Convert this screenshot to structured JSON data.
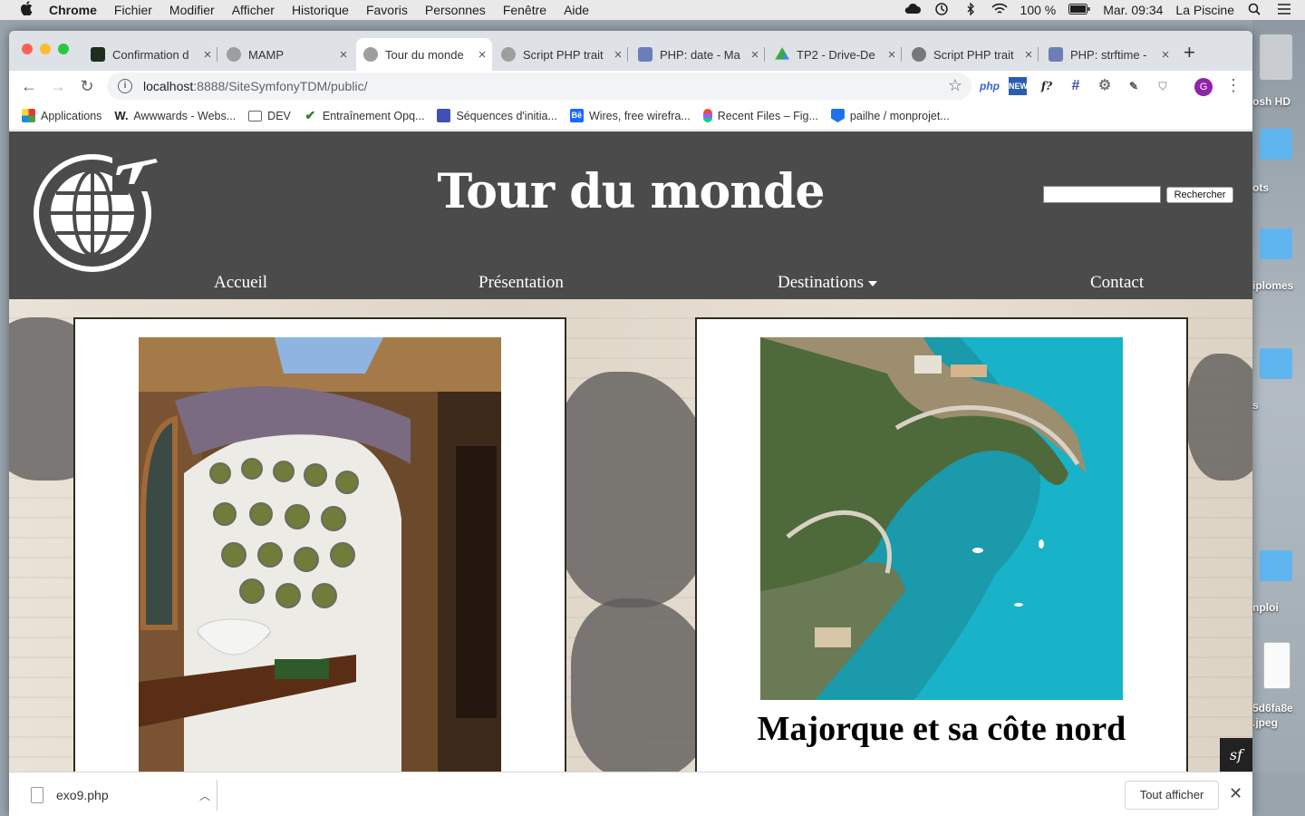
{
  "menubar": {
    "app": "Chrome",
    "items": [
      "Fichier",
      "Modifier",
      "Afficher",
      "Historique",
      "Favoris",
      "Personnes",
      "Fenêtre",
      "Aide"
    ],
    "battery": "100 %",
    "clock": "Mar. 09:34",
    "user": "La Piscine"
  },
  "desktop": {
    "labels": [
      "osh HD",
      "ots",
      "iplomes",
      "s",
      "nploi",
      "5d6fa8e",
      ".jpeg"
    ]
  },
  "tabs": [
    {
      "label": "Confirmation d",
      "favicon_color": "#1f2d1f"
    },
    {
      "label": "MAMP",
      "favicon_color": "#9e9e9e"
    },
    {
      "label": "Tour du monde",
      "favicon_color": "#9e9e9e",
      "active": true
    },
    {
      "label": "Script PHP trait",
      "favicon_color": "#9e9e9e"
    },
    {
      "label": "PHP: date - Ma",
      "favicon_color": "#6c7eb7"
    },
    {
      "label": "TP2 - Drive-De",
      "favicon_color": "#34a853"
    },
    {
      "label": "Script PHP trait",
      "favicon_color": "#777777"
    },
    {
      "label": "PHP: strftime -",
      "favicon_color": "#6c7eb7"
    }
  ],
  "address": {
    "host": "localhost",
    "path": ":8888/SiteSymfonyTDM/public/"
  },
  "bookmarks": [
    {
      "label": "Applications",
      "icon_color": "#e53935"
    },
    {
      "label": "Awwwards - Webs...",
      "icon_color": "#222222"
    },
    {
      "label": "DEV",
      "icon_color": "#666666"
    },
    {
      "label": "Entraînement Opq...",
      "icon_color": "#2e7d32"
    },
    {
      "label": "Séquences d'initia...",
      "icon_color": "#3f51b5"
    },
    {
      "label": "Wires, free wirefra...",
      "icon_color": "#1769ff"
    },
    {
      "label": "Recent Files – Fig...",
      "icon_color": "#f24e1e"
    },
    {
      "label": "pailhe / monprojet...",
      "icon_color": "#1a73e8"
    }
  ],
  "site": {
    "title": "Tour du monde",
    "search_button": "Rechercher",
    "search_value": "",
    "nav": [
      "Accueil",
      "Présentation",
      "Destinations",
      "Contact"
    ],
    "cards": [
      {
        "title": ""
      },
      {
        "title": "Majorque et sa côte nord"
      }
    ],
    "header_color": "#4b4b4b"
  },
  "downloads": {
    "file": "exo9.php",
    "show_all": "Tout afficher"
  }
}
